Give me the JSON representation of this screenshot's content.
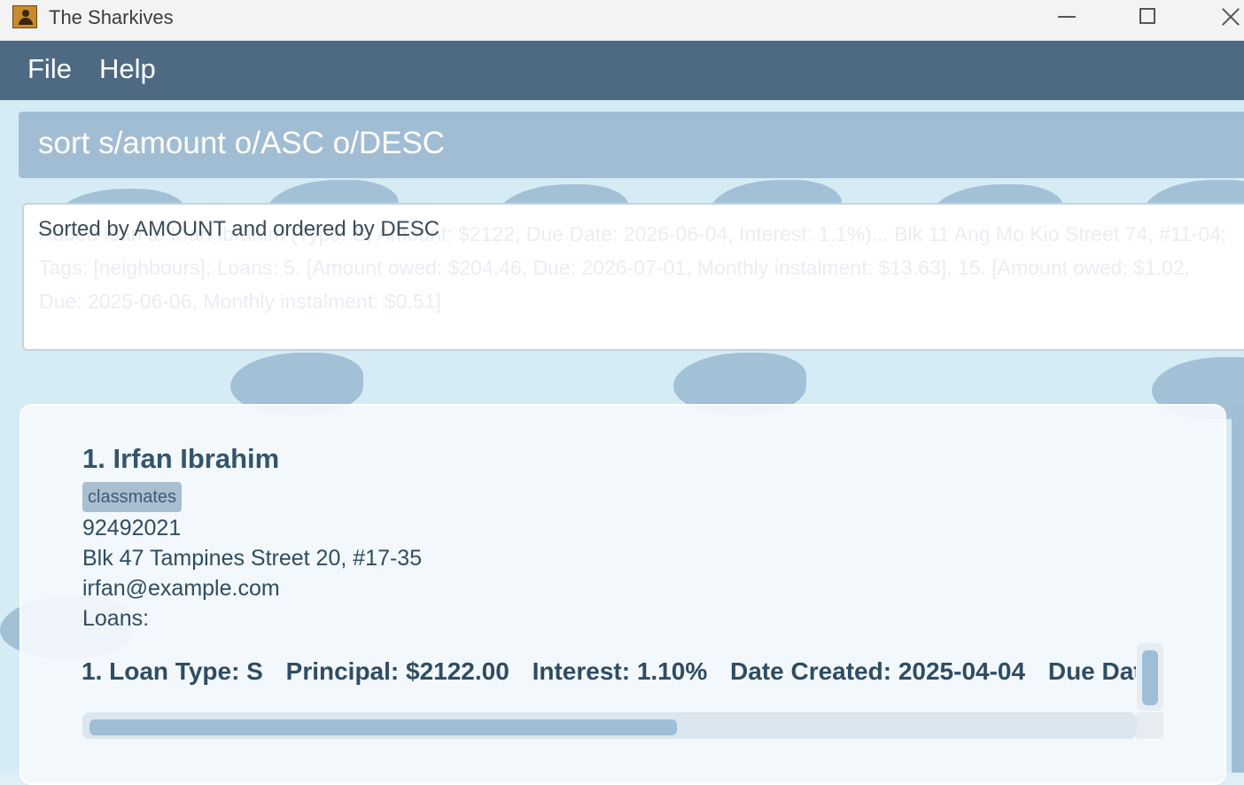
{
  "window": {
    "title": "The Sharkives"
  },
  "menu": {
    "items": [
      "File",
      "Help"
    ]
  },
  "command": {
    "value": "sort s/amount o/ASC o/DESC"
  },
  "result": {
    "message": "Sorted by AMOUNT and ordered by DESC",
    "faded_text": "Added loan to Irfan Ibrahim (Type: S, Amount: $2122, Due Date: 2026-06-04, Interest: 1.1%)... Blk 11 Ang Mo Kio Street 74, #11-04; Tags: [neighbours]; Loans: 5. [Amount owed: $204.46, Due: 2026-07-01, Monthly instalment: $13.63], 15. [Amount owed: $1.02, Due: 2025-06-06, Monthly instalment: $0.51]"
  },
  "person": {
    "index_name": "1.  Irfan Ibrahim",
    "tag": "classmates",
    "phone": "92492021",
    "address": "Blk 47 Tampines Street 20, #17-35",
    "email": "irfan@example.com",
    "loans_label": "Loans:",
    "loan": {
      "type": "1. Loan Type: S",
      "principal": "Principal: $2122.00",
      "interest": "Interest: 1.10%",
      "created": "Date Created: 2025-04-04",
      "due": "Due Date:"
    }
  },
  "colors": {
    "menubar": "#4e6a83",
    "command_box": "#a1bdd4",
    "accent_text": "#35546c"
  }
}
